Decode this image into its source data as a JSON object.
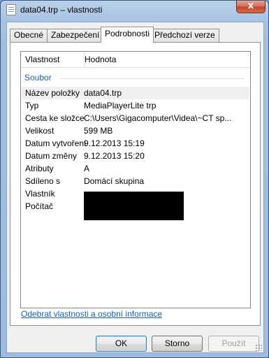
{
  "window": {
    "title": "data04.trp – vlastnosti",
    "close_glyph": "x",
    "file_icon": "document-icon"
  },
  "tabs": [
    {
      "label": "Obecné",
      "active": false
    },
    {
      "label": "Zabezpečení",
      "active": false
    },
    {
      "label": "Podrobnosti",
      "active": true
    },
    {
      "label": "Předchozí verze",
      "active": false
    }
  ],
  "listview": {
    "columns": [
      "Vlastnost",
      "Hodnota"
    ],
    "group": "Soubor",
    "rows": [
      {
        "key": "Název položky",
        "value": "data04.trp"
      },
      {
        "key": "Typ",
        "value": "MediaPlayerLite trp"
      },
      {
        "key": "Cesta ke složce",
        "value": "C:\\Users\\Gigacomputer\\Videa\\~CT sp..."
      },
      {
        "key": "Velikost",
        "value": "599 MB"
      },
      {
        "key": "Datum vytvoření",
        "value": "9.12.2013 15:19"
      },
      {
        "key": "Datum změny",
        "value": "9.12.2013 15:20"
      },
      {
        "key": "Atributy",
        "value": "A"
      },
      {
        "key": "Sdíleno s",
        "value": "Domácí skupina"
      },
      {
        "key": "Vlastník",
        "value": ""
      },
      {
        "key": "Počítač",
        "value": ""
      }
    ]
  },
  "link": "Odebrat vlastnosti a osobní informace",
  "buttons": {
    "ok": "OK",
    "cancel": "Storno",
    "apply": "Použít"
  }
}
